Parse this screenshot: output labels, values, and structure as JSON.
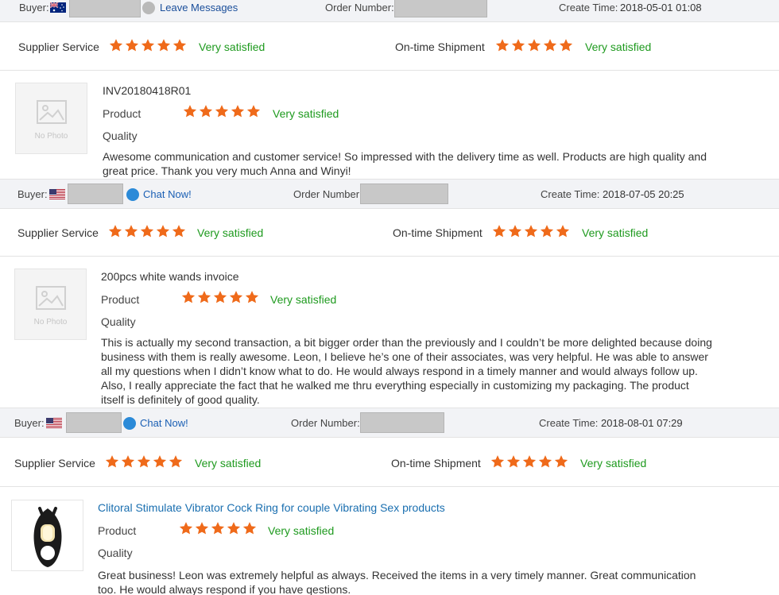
{
  "reviews": [
    {
      "buyer_label": "Buyer:",
      "buyer_flag": "australia",
      "contact_label": "Leave Messages",
      "order_label": "Order Number:",
      "create_label": "Create Time:",
      "create_time": "2018-05-01 01:08",
      "supplier_label": "Supplier Service",
      "supplier_rating": 5,
      "supplier_text": "Very satisfied",
      "shipment_label": "On-time Shipment",
      "shipment_rating": 5,
      "shipment_text": "Very satisfied",
      "product_title": "INV20180418R01",
      "thumb_text": "No Photo",
      "product_label": "Product",
      "product_rating": 5,
      "product_text": "Very satisfied",
      "quality_label": "Quality",
      "comment": "Awesome communication and customer service! So impressed with the delivery time as well. Products are high quality and great price. Thank you very much Anna and Winyi!"
    },
    {
      "buyer_label": "Buyer:",
      "buyer_flag": "usa",
      "contact_label": "Chat Now!",
      "order_label": "Order Number:",
      "create_label": "Create Time:",
      "create_time": "2018-07-05 20:25",
      "supplier_label": "Supplier Service",
      "supplier_rating": 5,
      "supplier_text": "Very satisfied",
      "shipment_label": "On-time Shipment",
      "shipment_rating": 5,
      "shipment_text": "Very satisfied",
      "product_title": "200pcs white wands invoice",
      "thumb_text": "No Photo",
      "product_label": "Product",
      "product_rating": 5,
      "product_text": "Very satisfied",
      "quality_label": "Quality",
      "comment": "This is actually my second transaction, a bit bigger order than the previously and I couldn’t be more delighted because doing business with them is really awesome. Leon, I believe he’s one of their associates, was very helpful. He was able to answer all my questions when I didn’t know what to do. He would always respond in a timely manner and would always follow up. Also, I really appreciate the fact that he walked me thru everything especially in customizing my packaging. The product itself is definitely of good quality."
    },
    {
      "buyer_label": "Buyer:",
      "buyer_flag": "usa",
      "contact_label": "Chat Now!",
      "order_label": "Order Number:",
      "create_label": "Create Time:",
      "create_time": "2018-08-01 07:29",
      "supplier_label": "Supplier Service",
      "supplier_rating": 5,
      "supplier_text": "Very satisfied",
      "shipment_label": "On-time Shipment",
      "shipment_rating": 5,
      "shipment_text": "Very satisfied",
      "product_title": "Clitoral Stimulate Vibrator Cock Ring for couple Vibrating Sex products",
      "product_label": "Product",
      "product_rating": 5,
      "product_text": "Very satisfied",
      "quality_label": "Quality",
      "comment": "Great business! Leon was extremely helpful as always. Received the items in a very timely manner. Great communication too. He would always respond if you have qestions."
    }
  ],
  "colors": {
    "star": "#ef6a1a",
    "satisfied": "#1e9a1e",
    "link": "#1a6fb0",
    "header_bg": "#f2f3f6",
    "chat_icon": "#2b8ad8"
  }
}
